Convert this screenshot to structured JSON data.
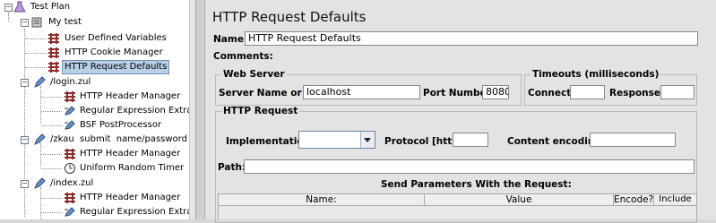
{
  "tree": {
    "nodes": [
      {
        "label": "Test Plan",
        "icon": "flask-icon"
      },
      {
        "label": "My test",
        "icon": "thread-group-icon"
      },
      {
        "label": "User Defined Variables",
        "icon": "config-element-icon"
      },
      {
        "label": "HTTP Cookie Manager",
        "icon": "config-element-icon"
      },
      {
        "label": "HTTP Request Defaults",
        "icon": "config-element-icon"
      },
      {
        "label": "/login.zul",
        "icon": "sampler-pencil-icon"
      },
      {
        "label": "HTTP Header Manager",
        "icon": "config-element-icon"
      },
      {
        "label": "Regular Expression Extractor",
        "icon": "post-processor-icon"
      },
      {
        "label": "BSF PostProcessor",
        "icon": "post-processor-icon"
      },
      {
        "label": "/zkau  submit  name/password",
        "icon": "sampler-pencil-icon"
      },
      {
        "label": "HTTP Header Manager",
        "icon": "config-element-icon"
      },
      {
        "label": "Uniform Random Timer",
        "icon": "timer-icon"
      },
      {
        "label": "/index.zul",
        "icon": "sampler-pencil-icon"
      },
      {
        "label": "HTTP Header Manager",
        "icon": "config-element-icon"
      },
      {
        "label": "Regular Expression Extractor",
        "icon": "post-processor-icon"
      }
    ]
  },
  "panel": {
    "title": "HTTP Request Defaults",
    "name_label": "Name:",
    "name_value": "HTTP Request Defaults",
    "comments_label": "Comments:",
    "web_server": {
      "legend": "Web Server",
      "server_label": "Server Name or IP:",
      "server_value": "localhost",
      "port_label": "Port Number:",
      "port_value": "8080"
    },
    "timeouts": {
      "legend": "Timeouts (milliseconds)",
      "connect_label": "Connect:",
      "connect_value": "",
      "response_label": "Response:",
      "response_value": ""
    },
    "http_request": {
      "legend": "HTTP Request",
      "implementation_label": "Implementation:",
      "implementation_value": "",
      "protocol_label": "Protocol [http]:",
      "protocol_value": "",
      "encoding_label": "Content encoding:",
      "encoding_value": "",
      "path_label": "Path:",
      "path_value": ""
    },
    "params": {
      "heading": "Send Parameters With the Request:",
      "columns": [
        "Name:",
        "Value",
        "Encode?",
        "Include Equals?"
      ]
    }
  }
}
